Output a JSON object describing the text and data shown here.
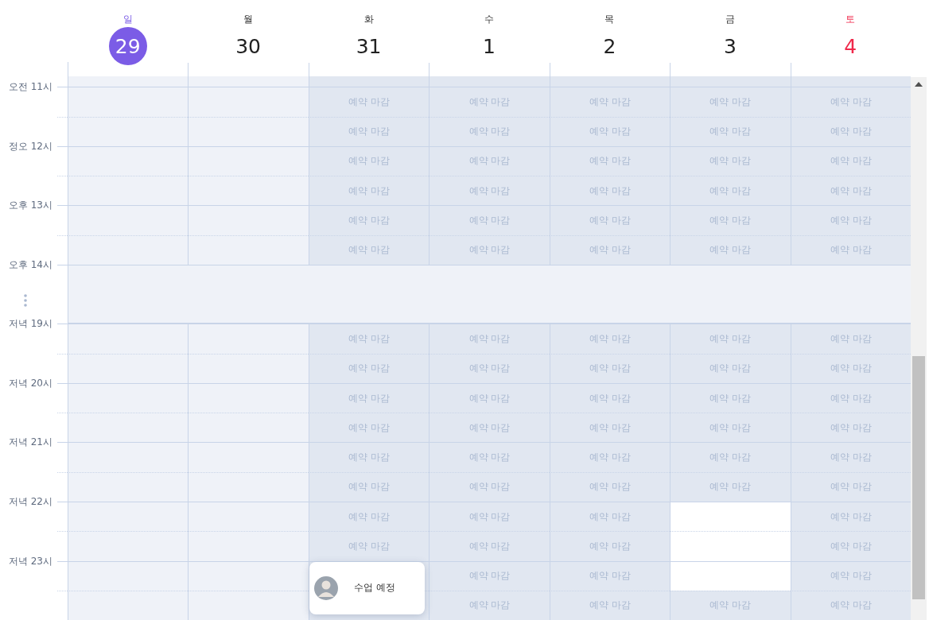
{
  "days": [
    {
      "weekday": "일",
      "date": "29",
      "kind": "sun",
      "selected": true
    },
    {
      "weekday": "월",
      "date": "30",
      "kind": "weekday",
      "selected": false
    },
    {
      "weekday": "화",
      "date": "31",
      "kind": "weekday",
      "selected": false
    },
    {
      "weekday": "수",
      "date": "1",
      "kind": "weekday",
      "selected": false
    },
    {
      "weekday": "목",
      "date": "2",
      "kind": "weekday",
      "selected": false
    },
    {
      "weekday": "금",
      "date": "3",
      "kind": "weekday",
      "selected": false
    },
    {
      "weekday": "토",
      "date": "4",
      "kind": "sat",
      "selected": false
    }
  ],
  "rows": [
    {
      "kind": "partial",
      "cells": [
        {
          "kind": "past"
        },
        {
          "kind": "past"
        },
        {
          "kind": "closed"
        },
        {
          "kind": "closed"
        },
        {
          "kind": "closed"
        },
        {
          "kind": "closed"
        },
        {
          "kind": "closed"
        }
      ]
    },
    {
      "kind": "slot",
      "label": "오전 11시",
      "cells": [
        {
          "kind": "past"
        },
        {
          "kind": "past"
        },
        {
          "kind": "closed",
          "text": "예약 마감"
        },
        {
          "kind": "closed",
          "text": "예약 마감"
        },
        {
          "kind": "closed",
          "text": "예약 마감"
        },
        {
          "kind": "closed",
          "text": "예약 마감"
        },
        {
          "kind": "closed",
          "text": "예약 마감"
        }
      ]
    },
    {
      "kind": "slot",
      "cells": [
        {
          "kind": "past"
        },
        {
          "kind": "past"
        },
        {
          "kind": "closed",
          "text": "예약 마감"
        },
        {
          "kind": "closed",
          "text": "예약 마감"
        },
        {
          "kind": "closed",
          "text": "예약 마감"
        },
        {
          "kind": "closed",
          "text": "예약 마감"
        },
        {
          "kind": "closed",
          "text": "예약 마감"
        }
      ]
    },
    {
      "kind": "slot",
      "label": "정오 12시",
      "cells": [
        {
          "kind": "past"
        },
        {
          "kind": "past"
        },
        {
          "kind": "closed",
          "text": "예약 마감"
        },
        {
          "kind": "closed",
          "text": "예약 마감"
        },
        {
          "kind": "closed",
          "text": "예약 마감"
        },
        {
          "kind": "closed",
          "text": "예약 마감"
        },
        {
          "kind": "closed",
          "text": "예약 마감"
        }
      ]
    },
    {
      "kind": "slot",
      "cells": [
        {
          "kind": "past"
        },
        {
          "kind": "past"
        },
        {
          "kind": "closed",
          "text": "예약 마감"
        },
        {
          "kind": "closed",
          "text": "예약 마감"
        },
        {
          "kind": "closed",
          "text": "예약 마감"
        },
        {
          "kind": "closed",
          "text": "예약 마감"
        },
        {
          "kind": "closed",
          "text": "예약 마감"
        }
      ]
    },
    {
      "kind": "slot",
      "label": "오후 13시",
      "cells": [
        {
          "kind": "past"
        },
        {
          "kind": "past"
        },
        {
          "kind": "closed",
          "text": "예약 마감"
        },
        {
          "kind": "closed",
          "text": "예약 마감"
        },
        {
          "kind": "closed",
          "text": "예약 마감"
        },
        {
          "kind": "closed",
          "text": "예약 마감"
        },
        {
          "kind": "closed",
          "text": "예약 마감"
        }
      ]
    },
    {
      "kind": "slot",
      "cells": [
        {
          "kind": "past"
        },
        {
          "kind": "past"
        },
        {
          "kind": "closed",
          "text": "예약 마감"
        },
        {
          "kind": "closed",
          "text": "예약 마감"
        },
        {
          "kind": "closed",
          "text": "예약 마감"
        },
        {
          "kind": "closed",
          "text": "예약 마감"
        },
        {
          "kind": "closed",
          "text": "예약 마감"
        }
      ]
    },
    {
      "kind": "gap",
      "label": "오후 14시"
    },
    {
      "kind": "slot",
      "label": "저녁 19시",
      "cells": [
        {
          "kind": "past"
        },
        {
          "kind": "past"
        },
        {
          "kind": "closed",
          "text": "예약 마감"
        },
        {
          "kind": "closed",
          "text": "예약 마감"
        },
        {
          "kind": "closed",
          "text": "예약 마감"
        },
        {
          "kind": "closed",
          "text": "예약 마감"
        },
        {
          "kind": "closed",
          "text": "예약 마감"
        }
      ]
    },
    {
      "kind": "slot",
      "cells": [
        {
          "kind": "past"
        },
        {
          "kind": "past"
        },
        {
          "kind": "closed",
          "text": "예약 마감"
        },
        {
          "kind": "closed",
          "text": "예약 마감"
        },
        {
          "kind": "closed",
          "text": "예약 마감"
        },
        {
          "kind": "closed",
          "text": "예약 마감"
        },
        {
          "kind": "closed",
          "text": "예약 마감"
        }
      ]
    },
    {
      "kind": "slot",
      "label": "저녁 20시",
      "cells": [
        {
          "kind": "past"
        },
        {
          "kind": "past"
        },
        {
          "kind": "closed",
          "text": "예약 마감"
        },
        {
          "kind": "closed",
          "text": "예약 마감"
        },
        {
          "kind": "closed",
          "text": "예약 마감"
        },
        {
          "kind": "closed",
          "text": "예약 마감"
        },
        {
          "kind": "closed",
          "text": "예약 마감"
        }
      ]
    },
    {
      "kind": "slot",
      "cells": [
        {
          "kind": "past"
        },
        {
          "kind": "past"
        },
        {
          "kind": "closed",
          "text": "예약 마감"
        },
        {
          "kind": "closed",
          "text": "예약 마감"
        },
        {
          "kind": "closed",
          "text": "예약 마감"
        },
        {
          "kind": "closed",
          "text": "예약 마감"
        },
        {
          "kind": "closed",
          "text": "예약 마감"
        }
      ]
    },
    {
      "kind": "slot",
      "label": "저녁 21시",
      "cells": [
        {
          "kind": "past"
        },
        {
          "kind": "past"
        },
        {
          "kind": "closed",
          "text": "예약 마감"
        },
        {
          "kind": "closed",
          "text": "예약 마감"
        },
        {
          "kind": "closed",
          "text": "예약 마감"
        },
        {
          "kind": "closed",
          "text": "예약 마감"
        },
        {
          "kind": "closed",
          "text": "예약 마감"
        }
      ]
    },
    {
      "kind": "slot",
      "cells": [
        {
          "kind": "past"
        },
        {
          "kind": "past"
        },
        {
          "kind": "closed",
          "text": "예약 마감"
        },
        {
          "kind": "closed",
          "text": "예약 마감"
        },
        {
          "kind": "closed",
          "text": "예약 마감"
        },
        {
          "kind": "closed",
          "text": "예약 마감"
        },
        {
          "kind": "closed",
          "text": "예약 마감"
        }
      ]
    },
    {
      "kind": "slot",
      "label": "저녁 22시",
      "cells": [
        {
          "kind": "past"
        },
        {
          "kind": "past"
        },
        {
          "kind": "closed",
          "text": "예약 마감"
        },
        {
          "kind": "closed",
          "text": "예약 마감"
        },
        {
          "kind": "closed",
          "text": "예약 마감"
        },
        {
          "kind": "open"
        },
        {
          "kind": "closed",
          "text": "예약 마감"
        }
      ]
    },
    {
      "kind": "slot",
      "cells": [
        {
          "kind": "past"
        },
        {
          "kind": "past"
        },
        {
          "kind": "closed",
          "text": "예약 마감"
        },
        {
          "kind": "closed",
          "text": "예약 마감"
        },
        {
          "kind": "closed",
          "text": "예약 마감"
        },
        {
          "kind": "open"
        },
        {
          "kind": "closed",
          "text": "예약 마감"
        }
      ]
    },
    {
      "kind": "slot",
      "label": "저녁 23시",
      "cells": [
        {
          "kind": "past"
        },
        {
          "kind": "past"
        },
        {
          "kind": "closed",
          "event": {
            "text": "수업 예정"
          }
        },
        {
          "kind": "closed",
          "text": "예약 마감"
        },
        {
          "kind": "closed",
          "text": "예약 마감"
        },
        {
          "kind": "open"
        },
        {
          "kind": "closed",
          "text": "예약 마감"
        }
      ]
    },
    {
      "kind": "slot",
      "cells": [
        {
          "kind": "past"
        },
        {
          "kind": "past"
        },
        {
          "kind": "closed"
        },
        {
          "kind": "closed",
          "text": "예약 마감"
        },
        {
          "kind": "closed",
          "text": "예약 마감"
        },
        {
          "kind": "closed",
          "text": "예약 마감"
        },
        {
          "kind": "closed",
          "text": "예약 마감"
        }
      ]
    }
  ]
}
